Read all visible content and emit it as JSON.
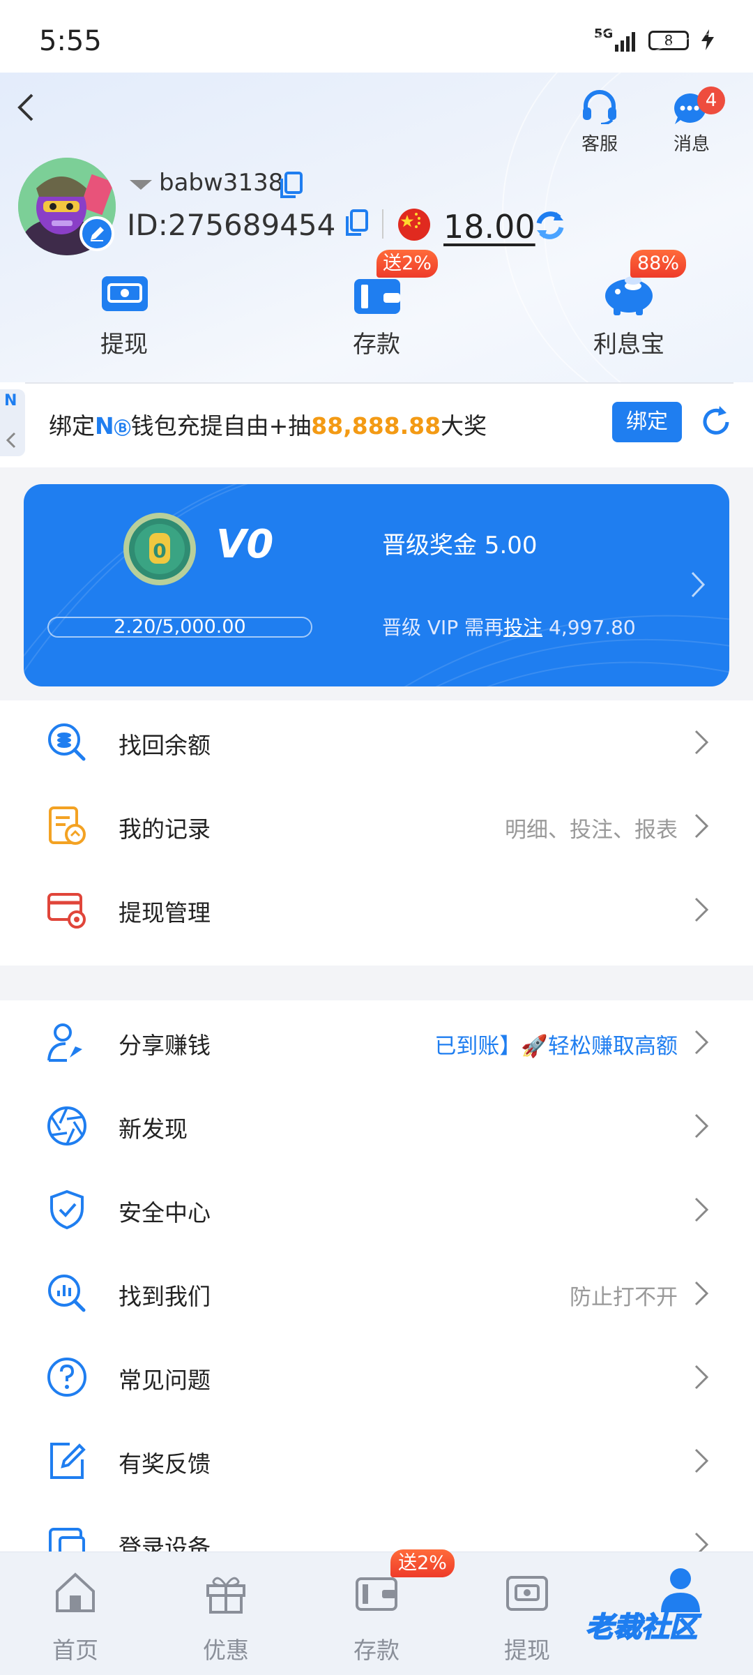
{
  "status_bar": {
    "time": "5:55",
    "network": "5G",
    "battery": "8"
  },
  "header": {
    "service_label": "客服",
    "messages_label": "消息",
    "messages_badge": "4",
    "username": "babw3138",
    "user_id": "ID:275689454",
    "balance": "18.00",
    "quick_actions": [
      {
        "label": "提现",
        "icon": "withdraw-icon"
      },
      {
        "label": "存款",
        "icon": "deposit-wallet-icon",
        "badge": "送2%"
      },
      {
        "label": "利息宝",
        "icon": "piggy-bank-icon",
        "badge": "88%"
      }
    ]
  },
  "banner": {
    "prefix": "绑定",
    "nb": "N",
    "middle": "钱包充提自由+抽",
    "amount": "88,888.88",
    "suffix": "大奖",
    "bind_button": "绑定"
  },
  "vip": {
    "badge_level": "0",
    "level": "V0",
    "bonus": "晋级奖金 5.00",
    "progress_text": "2.20/5,000.00",
    "progress_fraction": 0.00044,
    "need_prefix": "晋级 VIP 需再",
    "need_link": "投注",
    "need_amount": "4,997.80"
  },
  "menu_group_1": [
    {
      "label": "找回余额",
      "hint": "",
      "icon": "search-coin-icon"
    },
    {
      "label": "我的记录",
      "hint": "明细、投注、报表",
      "icon": "records-icon"
    },
    {
      "label": "提现管理",
      "hint": "",
      "icon": "card-settings-icon"
    }
  ],
  "menu_group_2": [
    {
      "label": "分享赚钱",
      "hint": "已到账】🚀轻松赚取高额",
      "icon": "share-user-icon"
    },
    {
      "label": "新发现",
      "hint": "",
      "icon": "aperture-icon"
    },
    {
      "label": "安全中心",
      "hint": "",
      "icon": "shield-check-icon"
    },
    {
      "label": "找到我们",
      "hint": "防止打不开",
      "icon": "search-chart-icon"
    },
    {
      "label": "常见问题",
      "hint": "",
      "icon": "question-icon"
    },
    {
      "label": "有奖反馈",
      "hint": "",
      "icon": "edit-icon"
    },
    {
      "label": "登录设备",
      "hint": "",
      "icon": "device-icon"
    }
  ],
  "bottom_nav": {
    "items": [
      {
        "label": "首页",
        "icon": "home-icon"
      },
      {
        "label": "优惠",
        "icon": "gift-icon"
      },
      {
        "label": "存款",
        "icon": "deposit-wallet-icon",
        "badge": "送2%"
      },
      {
        "label": "提现",
        "icon": "withdraw-icon"
      },
      {
        "label": "",
        "icon": "profile-icon"
      }
    ],
    "watermark": "老裁社区"
  },
  "colors": {
    "accent": "#1f7ef0",
    "highlight": "#f39a14",
    "badge": "#ee4d3e"
  }
}
